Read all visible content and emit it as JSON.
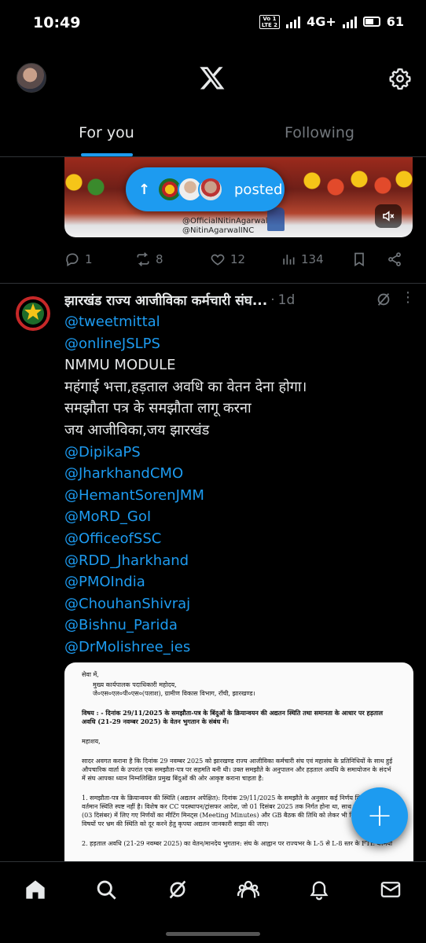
{
  "status": {
    "time": "10:49",
    "network": "4G+",
    "battery": "61",
    "lte_label": "Vo) 1\nLTE 2"
  },
  "nav": {
    "tabs": [
      {
        "label": "For you",
        "active": true
      },
      {
        "label": "Following",
        "active": false
      }
    ]
  },
  "pill": {
    "text": "posted"
  },
  "media1": {
    "watermark_lines": [
      "@OfficialNitinAgarwal",
      "@NitinAgarwalINC"
    ]
  },
  "tweet1_actions": {
    "replies": "1",
    "reposts": "8",
    "likes": "12",
    "views": "134"
  },
  "tweet2": {
    "name": "झारखंड राज्य आजीविका कर्मचारी संघ...",
    "time": "1d",
    "lines": [
      {
        "text": "@tweetmittal",
        "type": "mention"
      },
      {
        "text": "@onlineJSLPS",
        "type": "mention"
      },
      {
        "text": "NMMU MODULE",
        "type": "text"
      },
      {
        "text": " महंगाई भत्ता,हड़ताल अवधि का वेतन देना होगा।",
        "type": "text"
      },
      {
        "text": "समझौता पत्र के समझौता लागू करना",
        "type": "text"
      },
      {
        "text": "जय आजीविका,जय झारखंड",
        "type": "text"
      },
      {
        "text": "@DipikaPS",
        "type": "mention"
      },
      {
        "text": "@JharkhandCMO",
        "type": "mention"
      },
      {
        "text": "@HemantSorenJMM",
        "type": "mention"
      },
      {
        "text": "@MoRD_GoI",
        "type": "mention"
      },
      {
        "text": " @OfficeofSSC",
        "type": "mention"
      },
      {
        "text": "@RDD_Jharkhand",
        "type": "mention"
      },
      {
        "text": "@PMOIndia",
        "type": "mention"
      },
      {
        "text": "@ChouhanShivraj",
        "type": "mention"
      },
      {
        "text": "@Bishnu_Parida",
        "type": "mention"
      },
      {
        "text": "@DrMolishree_ies",
        "type": "mention"
      }
    ]
  },
  "doc": {
    "salutation": "सेवा में,",
    "addr1": "मुख्य कार्यपालक पदाधिकारी महोदय,",
    "addr2": "जे०एस०एल०पी०एस०(पलाश), ग्रामीण विकास विभाग, राँची, झारखण्ड।",
    "subject": "विषय : - दिनांक 29/11/2025 के समझौता-पत्र के बिंदुओं के क्रियान्वयन की अद्यतन स्थिति तथा समानता के आधार पर हड़ताल अवधि (21-29 नवम्बर 2025) के वेतन भुगतान के संबंध में।",
    "greeting": "महाशय,",
    "para1": "सादर अवगत कराना है कि दिनांक 29 नवम्बर 2025 को झारखण्ड राज्य आजीविका कर्मचारी संघ एवं महासंघ के प्रतिनिधियों के साथ हुई औपचारिक वार्ता के उपरांत एक समझौता-पत्र पर सहमति बनी थी। उक्त समझौते के अनुपालन और हड़ताल अवधि के समायोजन के संदर्भ में संघ आपका ध्यान निम्नलिखित प्रमुख बिंदुओं की ओर आकृष्ट कराना चाहता है:",
    "point1": "1. समझौता-पत्र के क्रियान्वयन की स्थिति (अद्यतन अपेक्षित): दिनांक 29/11/2025 के समझौते के अनुसार कई निर्णय लिये गए, जिनकी वर्तमान स्थिति स्पष्ट नहीं है। विशेष कर CC पदस्थापन/ट्रांसफर आदेश, जो 01 दिसंबर 2025 तक निर्गत होना था, साथ ही, EC बैठक (03 दिसंबर) में लिए गए निर्णयों का मीटिंग मिनट्स (Meeting Minutes) और GB बैठक की तिथि को लेकर भी स्थिति अस्पष्ट है। इन विषयों पर भ्रम की स्थिति को दूर करने हेतु कृपया अद्यतन जानकारी साझा की जाए।",
    "point2": "2. हड़ताल अवधि (21-29 नवम्बर 2025) का वेतन/मानदेय भुगतान: संघ के आह्वान पर राज्यभर के L-5 से L-8 स्तर के FTE कर्मियों"
  },
  "colors": {
    "accent": "#1d9bf0",
    "background": "#000000",
    "muted": "#71767b",
    "divider": "#2f3336"
  }
}
